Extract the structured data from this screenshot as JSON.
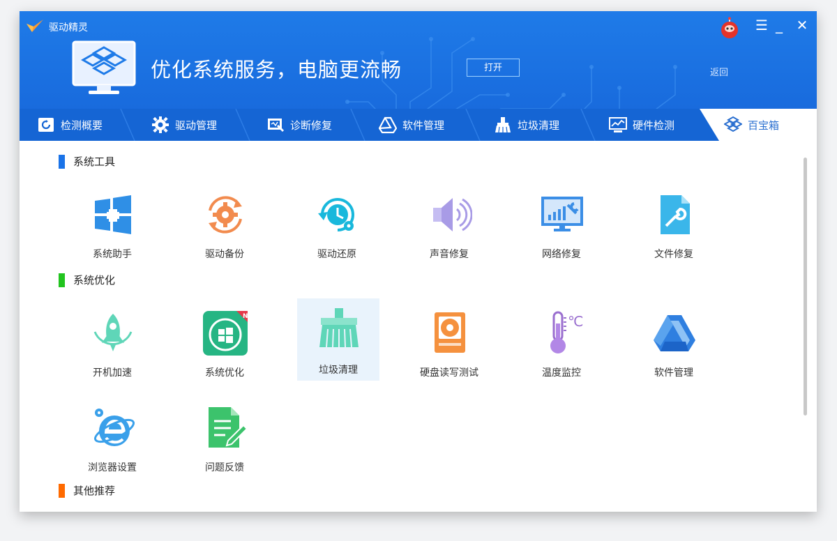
{
  "app": {
    "title": "驱动精灵"
  },
  "banner": {
    "text": "优化系统服务，电脑更流畅",
    "open_button": "打开",
    "back_link": "返回"
  },
  "window_controls": {
    "menu": "☰",
    "minimize": "_",
    "close": "✕"
  },
  "tabs": [
    {
      "label": "检测概要",
      "icon": "check-summary-icon"
    },
    {
      "label": "驱动管理",
      "icon": "gear-icon"
    },
    {
      "label": "诊断修复",
      "icon": "diagnose-icon"
    },
    {
      "label": "软件管理",
      "icon": "software-icon"
    },
    {
      "label": "垃圾清理",
      "icon": "broom-icon"
    },
    {
      "label": "硬件检测",
      "icon": "monitor-icon"
    },
    {
      "label": "百宝箱",
      "icon": "toolbox-icon",
      "active": true
    }
  ],
  "sections": [
    {
      "title": "系统工具",
      "color": "#1a73e8"
    },
    {
      "title": "系统优化",
      "color": "#22c41f"
    },
    {
      "title": "其他推荐",
      "color": "#ff6a00"
    }
  ],
  "tools": {
    "system_tools": [
      {
        "label": "系统助手",
        "icon": "windows-icon"
      },
      {
        "label": "驱动备份",
        "icon": "gear-sync-icon"
      },
      {
        "label": "驱动还原",
        "icon": "clock-restore-icon"
      },
      {
        "label": "声音修复",
        "icon": "speaker-icon"
      },
      {
        "label": "网络修复",
        "icon": "network-monitor-icon"
      },
      {
        "label": "文件修复",
        "icon": "file-wrench-icon"
      }
    ],
    "system_optimize": [
      {
        "label": "开机加速",
        "icon": "rocket-icon"
      },
      {
        "label": "系统优化",
        "icon": "windows-rocket-icon",
        "badge": "N"
      },
      {
        "label": "垃圾清理",
        "icon": "broom-icon",
        "selected": true
      },
      {
        "label": "硬盘读写测试",
        "icon": "hard-disk-icon"
      },
      {
        "label": "温度监控",
        "icon": "thermometer-icon",
        "unit": "℃"
      },
      {
        "label": "软件管理",
        "icon": "software-triangle-icon"
      }
    ],
    "extra_row": [
      {
        "label": "浏览器设置",
        "icon": "ie-browser-icon"
      },
      {
        "label": "问题反馈",
        "icon": "feedback-icon"
      }
    ]
  }
}
